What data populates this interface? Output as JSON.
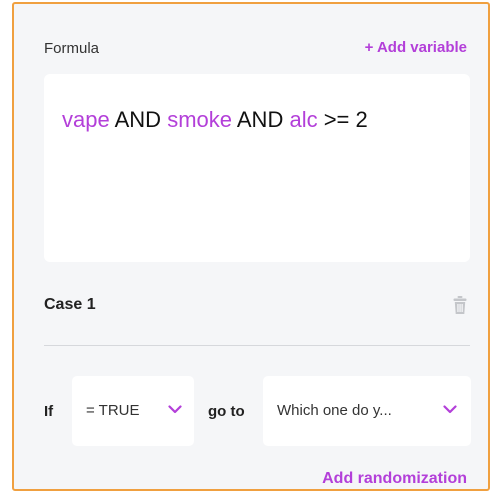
{
  "formula": {
    "label": "Formula",
    "add_variable_label": "+ Add variable",
    "tokens": [
      {
        "text": "vape",
        "kind": "variable"
      },
      {
        "text": " AND ",
        "kind": "operator"
      },
      {
        "text": "smoke",
        "kind": "variable"
      },
      {
        "text": " AND ",
        "kind": "operator"
      },
      {
        "text": "alc",
        "kind": "variable"
      },
      {
        "text": " >= 2",
        "kind": "operator"
      }
    ]
  },
  "case": {
    "title": "Case 1",
    "delete_icon": "trash-icon",
    "if_label": "If",
    "condition_value": "= TRUE",
    "goto_label": "go to",
    "target_value": "Which one do y...",
    "add_randomization_label": "Add randomization"
  },
  "colors": {
    "accent": "#b33fd9",
    "panel_border": "#f0a040",
    "panel_bg": "#f5f6f8",
    "icon_gray": "#c4c6ca"
  }
}
